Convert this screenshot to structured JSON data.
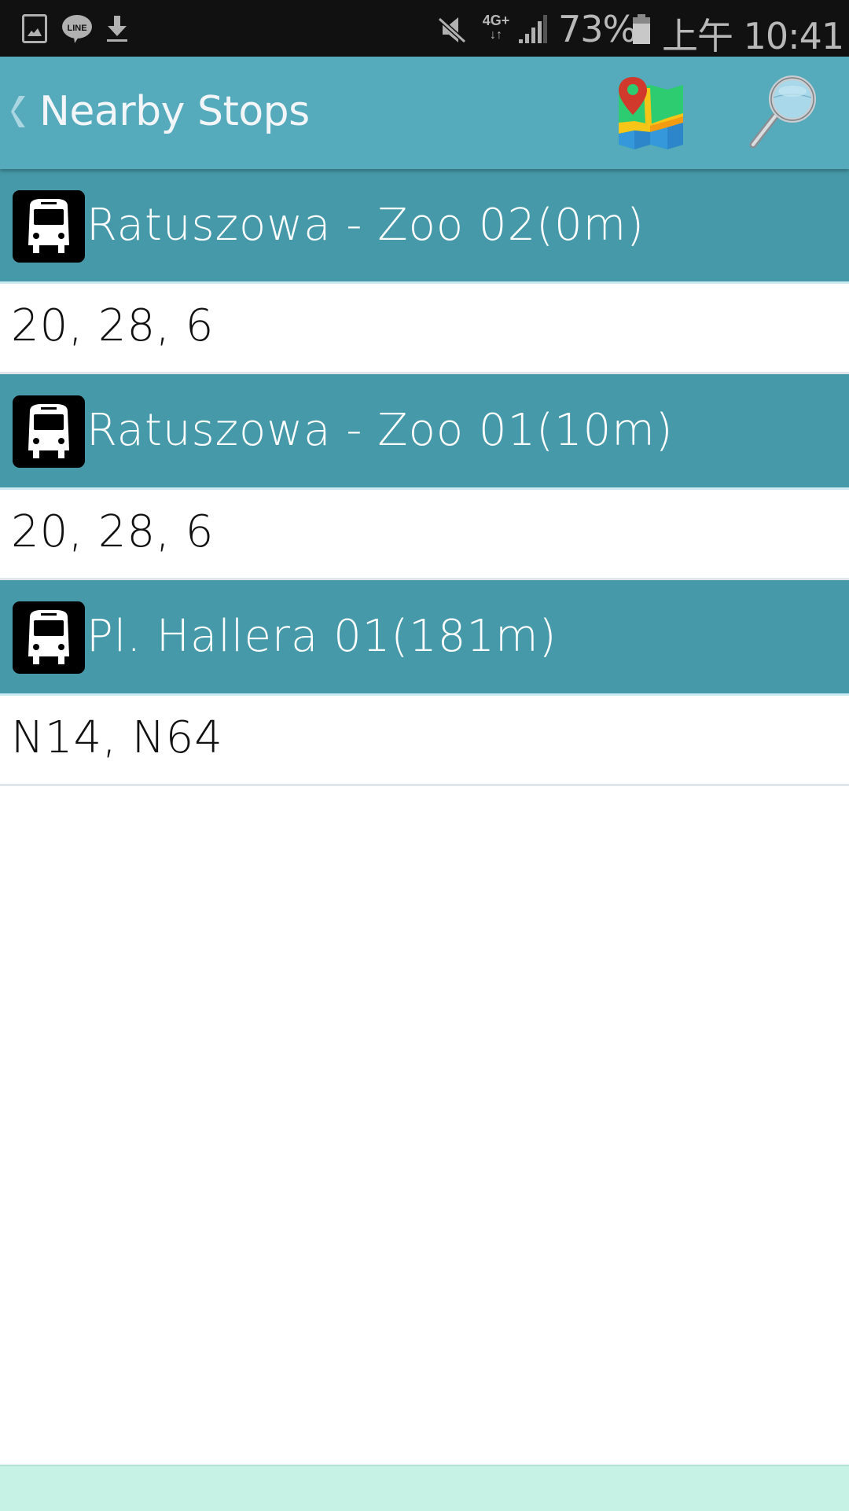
{
  "status_bar": {
    "notifications": [
      {
        "icon": "gallery-icon"
      },
      {
        "icon": "line-app-icon",
        "label": "LINE"
      },
      {
        "icon": "download-icon"
      }
    ],
    "mute_icon": "mute-icon",
    "network_label": "4G+",
    "signal_icon": "signal-icon",
    "battery_percent": "73%",
    "battery_icon": "battery-icon",
    "time": "上午 10:41"
  },
  "app_bar": {
    "back_icon": "chevron-left-icon",
    "title": "Nearby Stops",
    "map_button_icon": "map-icon",
    "search_button_icon": "magnifier-icon"
  },
  "stops": [
    {
      "name": "Ratuszowa - Zoo 02(0m)",
      "routes": "20, 28, 6",
      "icon": "bus-icon"
    },
    {
      "name": "Ratuszowa - Zoo 01(10m)",
      "routes": "20, 28, 6",
      "icon": "bus-icon"
    },
    {
      "name": "Pl. Hallera 01(181m)",
      "routes": "N14, N64",
      "icon": "bus-icon"
    }
  ],
  "colors": {
    "app_bar": "#55aabb",
    "stop_header": "#4699a8",
    "bottom_bar": "#c5f2e4",
    "status_bar": "#111111"
  }
}
